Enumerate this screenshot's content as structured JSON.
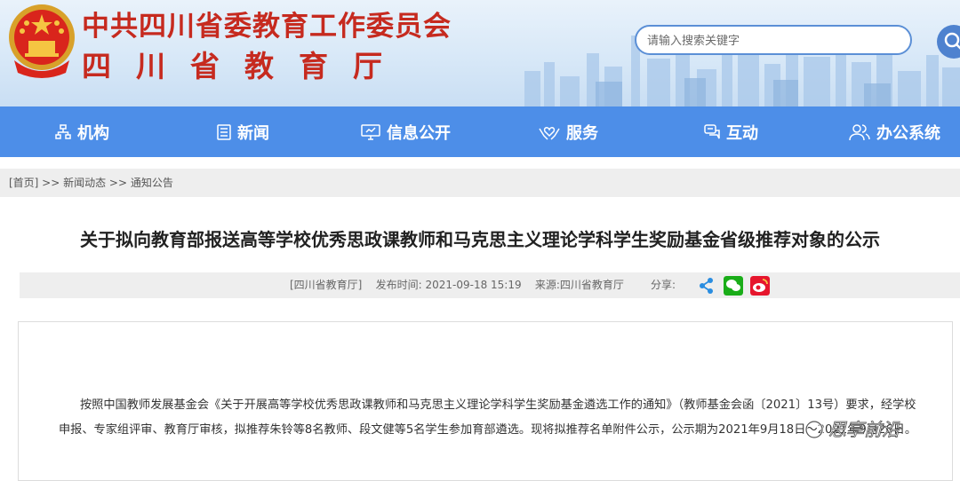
{
  "header": {
    "org_name": "中共四川省委教育工作委员会",
    "dept_name": "四川省教育厅",
    "search_placeholder": "请输入搜索关键字"
  },
  "nav": {
    "items": [
      {
        "label": "机构",
        "icon": "org-chart-icon"
      },
      {
        "label": "新闻",
        "icon": "newspaper-icon"
      },
      {
        "label": "信息公开",
        "icon": "monitor-icon"
      },
      {
        "label": "服务",
        "icon": "hands-heart-icon"
      },
      {
        "label": "互动",
        "icon": "chat-icon"
      },
      {
        "label": "办公系统",
        "icon": "users-icon"
      }
    ]
  },
  "breadcrumb": {
    "text": "[首页] >> 新闻动态 >> 通知公告"
  },
  "article": {
    "title": "关于拟向教育部报送高等学校优秀思政课教师和马克思主义理论学科学生奖励基金省级推荐对象的公示",
    "meta_info": "[四川省教育厅]    发布时间: 2021-09-18 15:19    来源:四川省教育厅",
    "share_label": "分享:",
    "body": "按照中国教师发展基金会《关于开展高等学校优秀思政课教师和马克思主义理论学科学生奖励基金遴选工作的通知》（教师基金会函〔2021〕13号）要求，经学校申报、专家组评审、教育厅审核，拟推荐朱铃等8名教师、段文健等5名学生参加育部遴选。现将拟推荐名单附件公示，公示期为2021年9月18日～2021年9月26日。"
  },
  "watermark": {
    "text": "思享前沿"
  },
  "colors": {
    "brand_red": "#c62a1f",
    "nav_blue": "#4d8ee8",
    "wechat_green": "#1aad19",
    "weibo_red": "#e6162d"
  }
}
